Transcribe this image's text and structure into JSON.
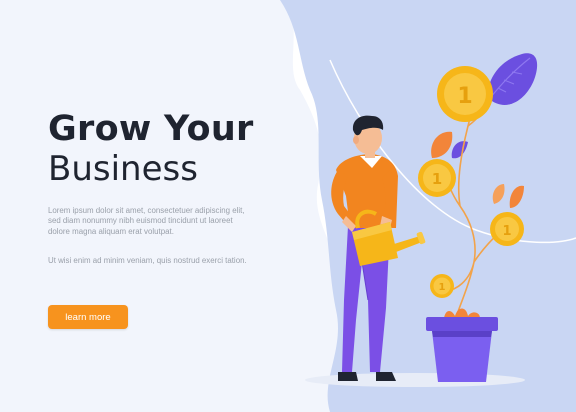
{
  "hero": {
    "title": "Grow Your",
    "subtitle": "Business",
    "paragraph1": "Lorem ipsum dolor sit amet, consectetuer adipiscing elit, sed diam nonummy nibh euismod tincidunt ut laoreet dolore magna aliquam erat volutpat.",
    "paragraph2": "Ut wisi enim ad minim veniam, quis nostrud exerci tation.",
    "cta_label": "learn more"
  },
  "colors": {
    "accent": "#f7931e",
    "dark_text": "#1f2430",
    "muted_text": "#9aa0aa",
    "backdrop_blue": "#c9d6f3",
    "pot_purple": "#6b4fe0",
    "coin_gold": "#f6b619"
  },
  "icons": {
    "coins": "coin-icon",
    "leaves": "leaf-icon"
  }
}
